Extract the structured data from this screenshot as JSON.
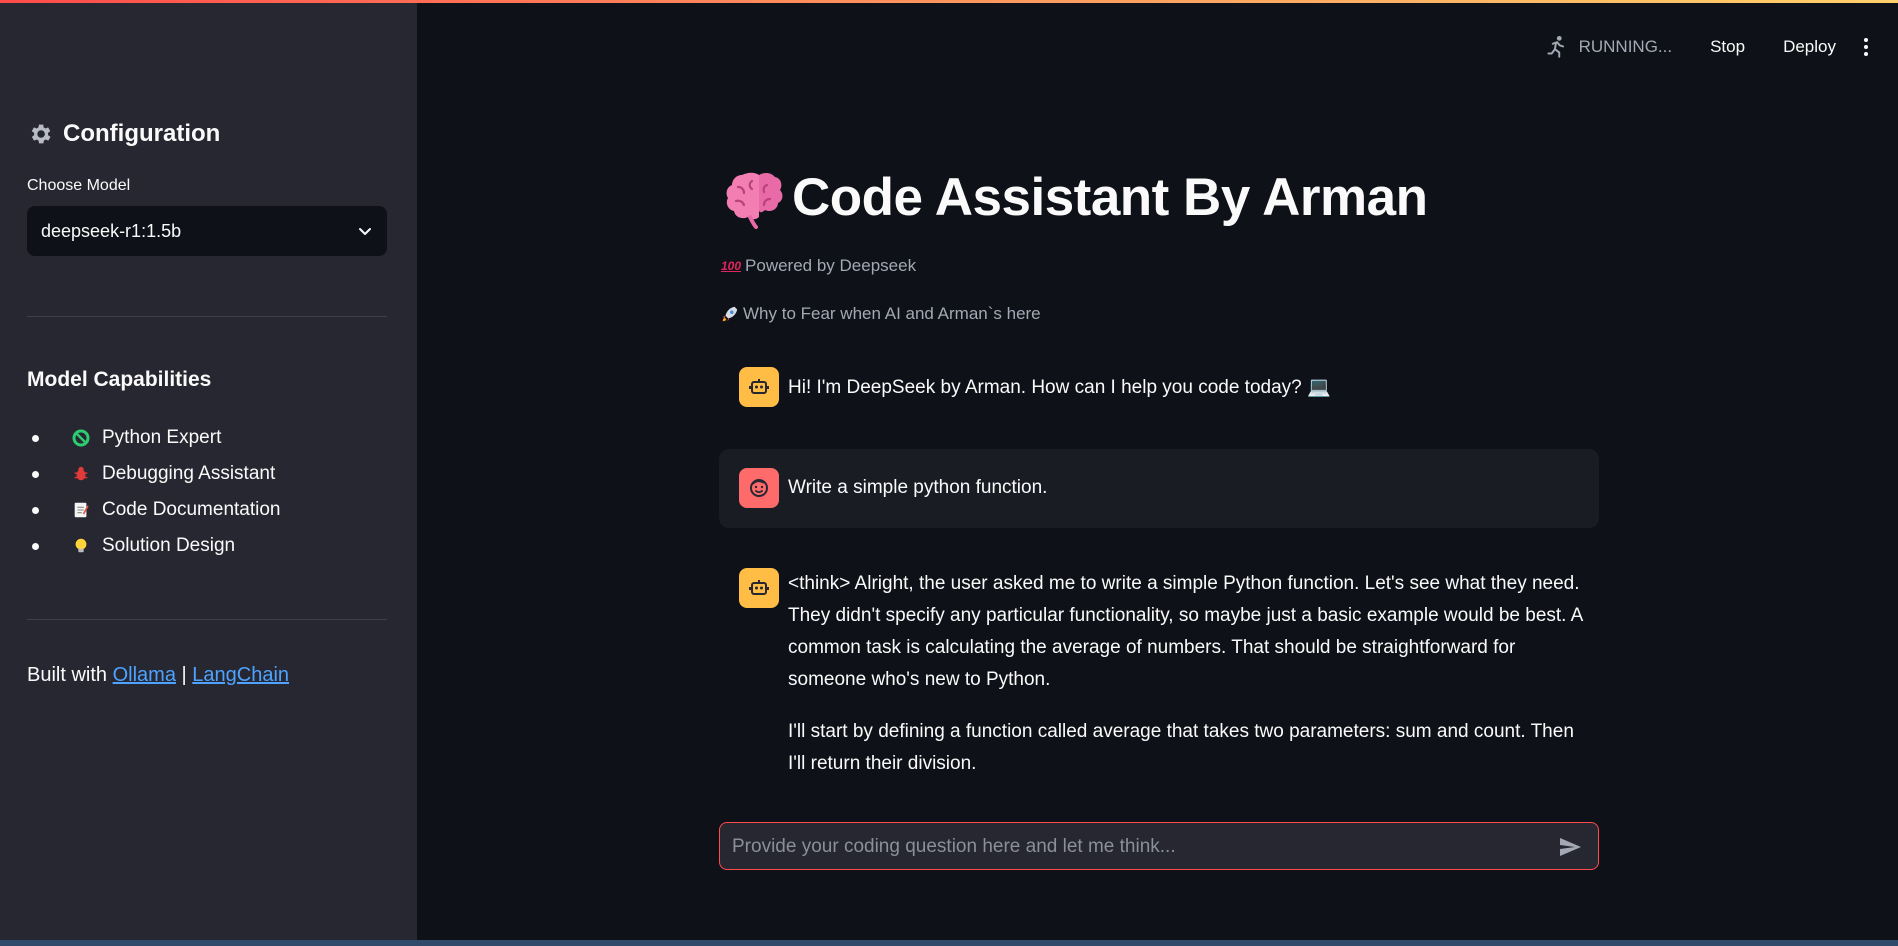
{
  "header": {
    "running_icon": "running-person-icon",
    "status": "RUNNING...",
    "stop_label": "Stop",
    "deploy_label": "Deploy",
    "menu_icon": "kebab-menu-icon"
  },
  "sidebar": {
    "config_icon": "gear-icon",
    "config_title": "Configuration",
    "model_label": "Choose Model",
    "model_value": "deepseek-r1:1.5b",
    "capabilities_title": "Model Capabilities",
    "capabilities": [
      {
        "icon": "python-icon",
        "label": "Python Expert"
      },
      {
        "icon": "bug-icon",
        "label": "Debugging Assistant"
      },
      {
        "icon": "memo-icon",
        "label": "Code Documentation"
      },
      {
        "icon": "lightbulb-icon",
        "label": "Solution Design"
      }
    ],
    "built_prefix": "Built with",
    "built_link1": "Ollama",
    "built_sep": "|",
    "built_link2": "LangChain"
  },
  "main": {
    "title_icon": "brain-icon",
    "title": "Code Assistant By Arman",
    "powered_icon": "hundred-icon",
    "powered": "Powered by Deepseek",
    "tagline_icon": "rocket-icon",
    "tagline": "Why to Fear when AI and Arman`s here",
    "messages": [
      {
        "role": "assistant",
        "text": "Hi! I'm DeepSeek by Arman. How can I help you code today? 💻"
      },
      {
        "role": "user",
        "text": "Write a simple python function."
      },
      {
        "role": "assistant",
        "p1": "<think> Alright, the user asked me to write a simple Python function. Let's see what they need. They didn't specify any particular functionality, so maybe just a basic example would be best. A common task is calculating the average of numbers. That should be straightforward for someone who's new to Python.",
        "p2": "I'll start by defining a function called average that takes two parameters: sum and count. Then I'll return their division."
      }
    ],
    "input_placeholder": "Provide your coding question here and let me think...",
    "send_icon": "send-icon"
  },
  "colors": {
    "accent": "#ff4b4b",
    "bot_avatar": "#ffbd45",
    "user_avatar": "#ff6b6b",
    "link": "#4da3ff"
  }
}
